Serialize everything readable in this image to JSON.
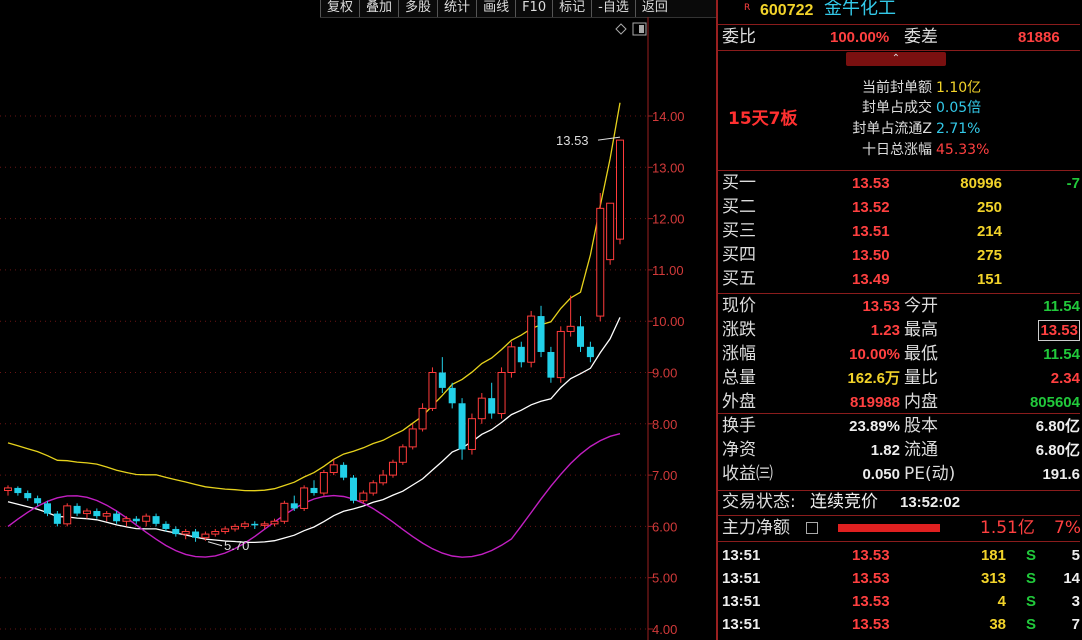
{
  "toolbar": [
    "复权",
    "叠加",
    "多股",
    "统计",
    "画线",
    "F10",
    "标记",
    "-自选",
    "返回"
  ],
  "stock": {
    "badge": "R",
    "code": "600722",
    "name": "金牛化工"
  },
  "weibi": {
    "label": "委比",
    "value": "100.00%",
    "label2": "委差",
    "value2": "81886"
  },
  "board": {
    "streak": "15天7板",
    "stats": [
      {
        "label": "当前封单额",
        "value": "1.10亿"
      },
      {
        "label": "封单占成交",
        "value": "0.05倍"
      },
      {
        "label": "封单占流通Z",
        "value": "2.71%"
      },
      {
        "label": "十日总涨幅",
        "value": "45.33%"
      }
    ]
  },
  "bids": [
    {
      "label": "买一",
      "price": "13.53",
      "vol": "80996",
      "chg": "-7"
    },
    {
      "label": "买二",
      "price": "13.52",
      "vol": "250",
      "chg": ""
    },
    {
      "label": "买三",
      "price": "13.51",
      "vol": "214",
      "chg": ""
    },
    {
      "label": "买四",
      "price": "13.50",
      "vol": "275",
      "chg": ""
    },
    {
      "label": "买五",
      "price": "13.49",
      "vol": "151",
      "chg": ""
    }
  ],
  "quote": [
    {
      "l1": "现价",
      "v1": "13.53",
      "l2": "今开",
      "v2": "11.54"
    },
    {
      "l1": "涨跌",
      "v1": "1.23",
      "l2": "最高",
      "v2": "13.53"
    },
    {
      "l1": "涨幅",
      "v1": "10.00%",
      "l2": "最低",
      "v2": "11.54"
    },
    {
      "l1": "总量",
      "v1": "162.6万",
      "l2": "量比",
      "v2": "2.34"
    },
    {
      "l1": "外盘",
      "v1": "819988",
      "l2": "内盘",
      "v2": "805604"
    }
  ],
  "fund": [
    {
      "l1": "换手",
      "v1": "23.89%",
      "l2": "股本",
      "v2": "6.80亿"
    },
    {
      "l1": "净资",
      "v1": "1.82",
      "l2": "流通",
      "v2": "6.80亿"
    },
    {
      "l1": "收益㈢",
      "v1": "0.050",
      "l2": "PE(动)",
      "v2": "191.6"
    }
  ],
  "trade_status": {
    "label": "交易状态:",
    "value": "连续竞价",
    "time": "13:52:02"
  },
  "main_flow": {
    "label": "主力净额",
    "value": "1.51亿",
    "pct": "7%",
    "bar_fraction": 0.85
  },
  "ticks": [
    {
      "time": "13:51",
      "price": "13.53",
      "vol": "181",
      "side": "S",
      "n": "5"
    },
    {
      "time": "13:51",
      "price": "13.53",
      "vol": "313",
      "side": "S",
      "n": "14"
    },
    {
      "time": "13:51",
      "price": "13.53",
      "vol": "4",
      "side": "S",
      "n": "3"
    },
    {
      "time": "13:51",
      "price": "13.53",
      "vol": "38",
      "side": "S",
      "n": "7"
    }
  ],
  "chart_data": {
    "type": "candlestick",
    "y_ticks": [
      "14.00",
      "13.00",
      "12.00",
      "11.00",
      "10.00",
      "9.00",
      "8.00",
      "7.00",
      "6.00",
      "5.00",
      "4.00"
    ],
    "ylim": [
      4,
      14
    ],
    "annotations": [
      {
        "text": "13.53",
        "value": 13.53
      },
      {
        "text": "5.70",
        "value": 5.7
      }
    ],
    "colors": {
      "up": "#ff3b3b",
      "down": "#22d0e8",
      "upper_band": "#e6d21c",
      "lower_band": "#ffffff",
      "indicator": "#c21fc2"
    },
    "candles": [
      [
        6.7,
        6.8,
        6.6,
        6.75
      ],
      [
        6.75,
        6.78,
        6.6,
        6.65
      ],
      [
        6.65,
        6.7,
        6.5,
        6.55
      ],
      [
        6.55,
        6.6,
        6.4,
        6.45
      ],
      [
        6.45,
        6.5,
        6.2,
        6.25
      ],
      [
        6.25,
        6.3,
        6.0,
        6.05
      ],
      [
        6.05,
        6.45,
        6.0,
        6.4
      ],
      [
        6.4,
        6.45,
        6.2,
        6.25
      ],
      [
        6.25,
        6.35,
        6.15,
        6.3
      ],
      [
        6.3,
        6.35,
        6.15,
        6.2
      ],
      [
        6.2,
        6.3,
        6.1,
        6.25
      ],
      [
        6.25,
        6.3,
        6.05,
        6.1
      ],
      [
        6.1,
        6.2,
        6.0,
        6.15
      ],
      [
        6.15,
        6.2,
        6.05,
        6.1
      ],
      [
        6.1,
        6.25,
        6.0,
        6.2
      ],
      [
        6.2,
        6.25,
        6.0,
        6.05
      ],
      [
        6.05,
        6.1,
        5.9,
        5.95
      ],
      [
        5.95,
        6.0,
        5.8,
        5.85
      ],
      [
        5.85,
        5.95,
        5.75,
        5.9
      ],
      [
        5.9,
        5.95,
        5.7,
        5.78
      ],
      [
        5.78,
        5.9,
        5.72,
        5.85
      ],
      [
        5.85,
        5.95,
        5.8,
        5.9
      ],
      [
        5.9,
        6.0,
        5.85,
        5.95
      ],
      [
        5.95,
        6.05,
        5.9,
        6.0
      ],
      [
        6.0,
        6.1,
        5.95,
        6.05
      ],
      [
        6.05,
        6.1,
        5.95,
        6.02
      ],
      [
        6.02,
        6.1,
        5.95,
        6.05
      ],
      [
        6.05,
        6.15,
        6.0,
        6.1
      ],
      [
        6.1,
        6.5,
        6.05,
        6.45
      ],
      [
        6.45,
        6.6,
        6.3,
        6.35
      ],
      [
        6.35,
        6.8,
        6.3,
        6.75
      ],
      [
        6.75,
        6.9,
        6.6,
        6.65
      ],
      [
        6.65,
        7.1,
        6.6,
        7.05
      ],
      [
        7.05,
        7.3,
        7.0,
        7.2
      ],
      [
        7.2,
        7.25,
        6.9,
        6.95
      ],
      [
        6.95,
        7.0,
        6.45,
        6.5
      ],
      [
        6.5,
        6.7,
        6.45,
        6.65
      ],
      [
        6.65,
        6.9,
        6.6,
        6.85
      ],
      [
        6.85,
        7.1,
        6.8,
        7.0
      ],
      [
        7.0,
        7.3,
        6.95,
        7.25
      ],
      [
        7.25,
        7.6,
        7.2,
        7.55
      ],
      [
        7.55,
        8.0,
        7.5,
        7.9
      ],
      [
        7.9,
        8.4,
        7.85,
        8.3
      ],
      [
        8.3,
        9.1,
        8.25,
        9.0
      ],
      [
        9.0,
        9.3,
        8.6,
        8.7
      ],
      [
        8.7,
        8.8,
        8.3,
        8.4
      ],
      [
        8.4,
        8.5,
        7.3,
        7.5
      ],
      [
        7.5,
        8.2,
        7.4,
        8.1
      ],
      [
        8.1,
        8.6,
        8.0,
        8.5
      ],
      [
        8.5,
        8.8,
        8.1,
        8.2
      ],
      [
        8.2,
        9.1,
        8.1,
        9.0
      ],
      [
        9.0,
        9.6,
        8.9,
        9.5
      ],
      [
        9.5,
        9.6,
        9.1,
        9.2
      ],
      [
        9.2,
        10.2,
        9.1,
        10.1
      ],
      [
        10.1,
        10.3,
        9.3,
        9.4
      ],
      [
        9.4,
        9.5,
        8.8,
        8.9
      ],
      [
        8.9,
        9.9,
        8.8,
        9.8
      ],
      [
        9.8,
        10.5,
        9.7,
        9.9
      ],
      [
        9.9,
        10.1,
        9.4,
        9.5
      ],
      [
        9.5,
        9.6,
        9.2,
        9.3
      ],
      [
        10.1,
        12.5,
        10.0,
        12.2
      ],
      [
        11.2,
        12.3,
        11.1,
        12.3
      ],
      [
        11.6,
        13.53,
        11.5,
        13.53
      ]
    ]
  }
}
